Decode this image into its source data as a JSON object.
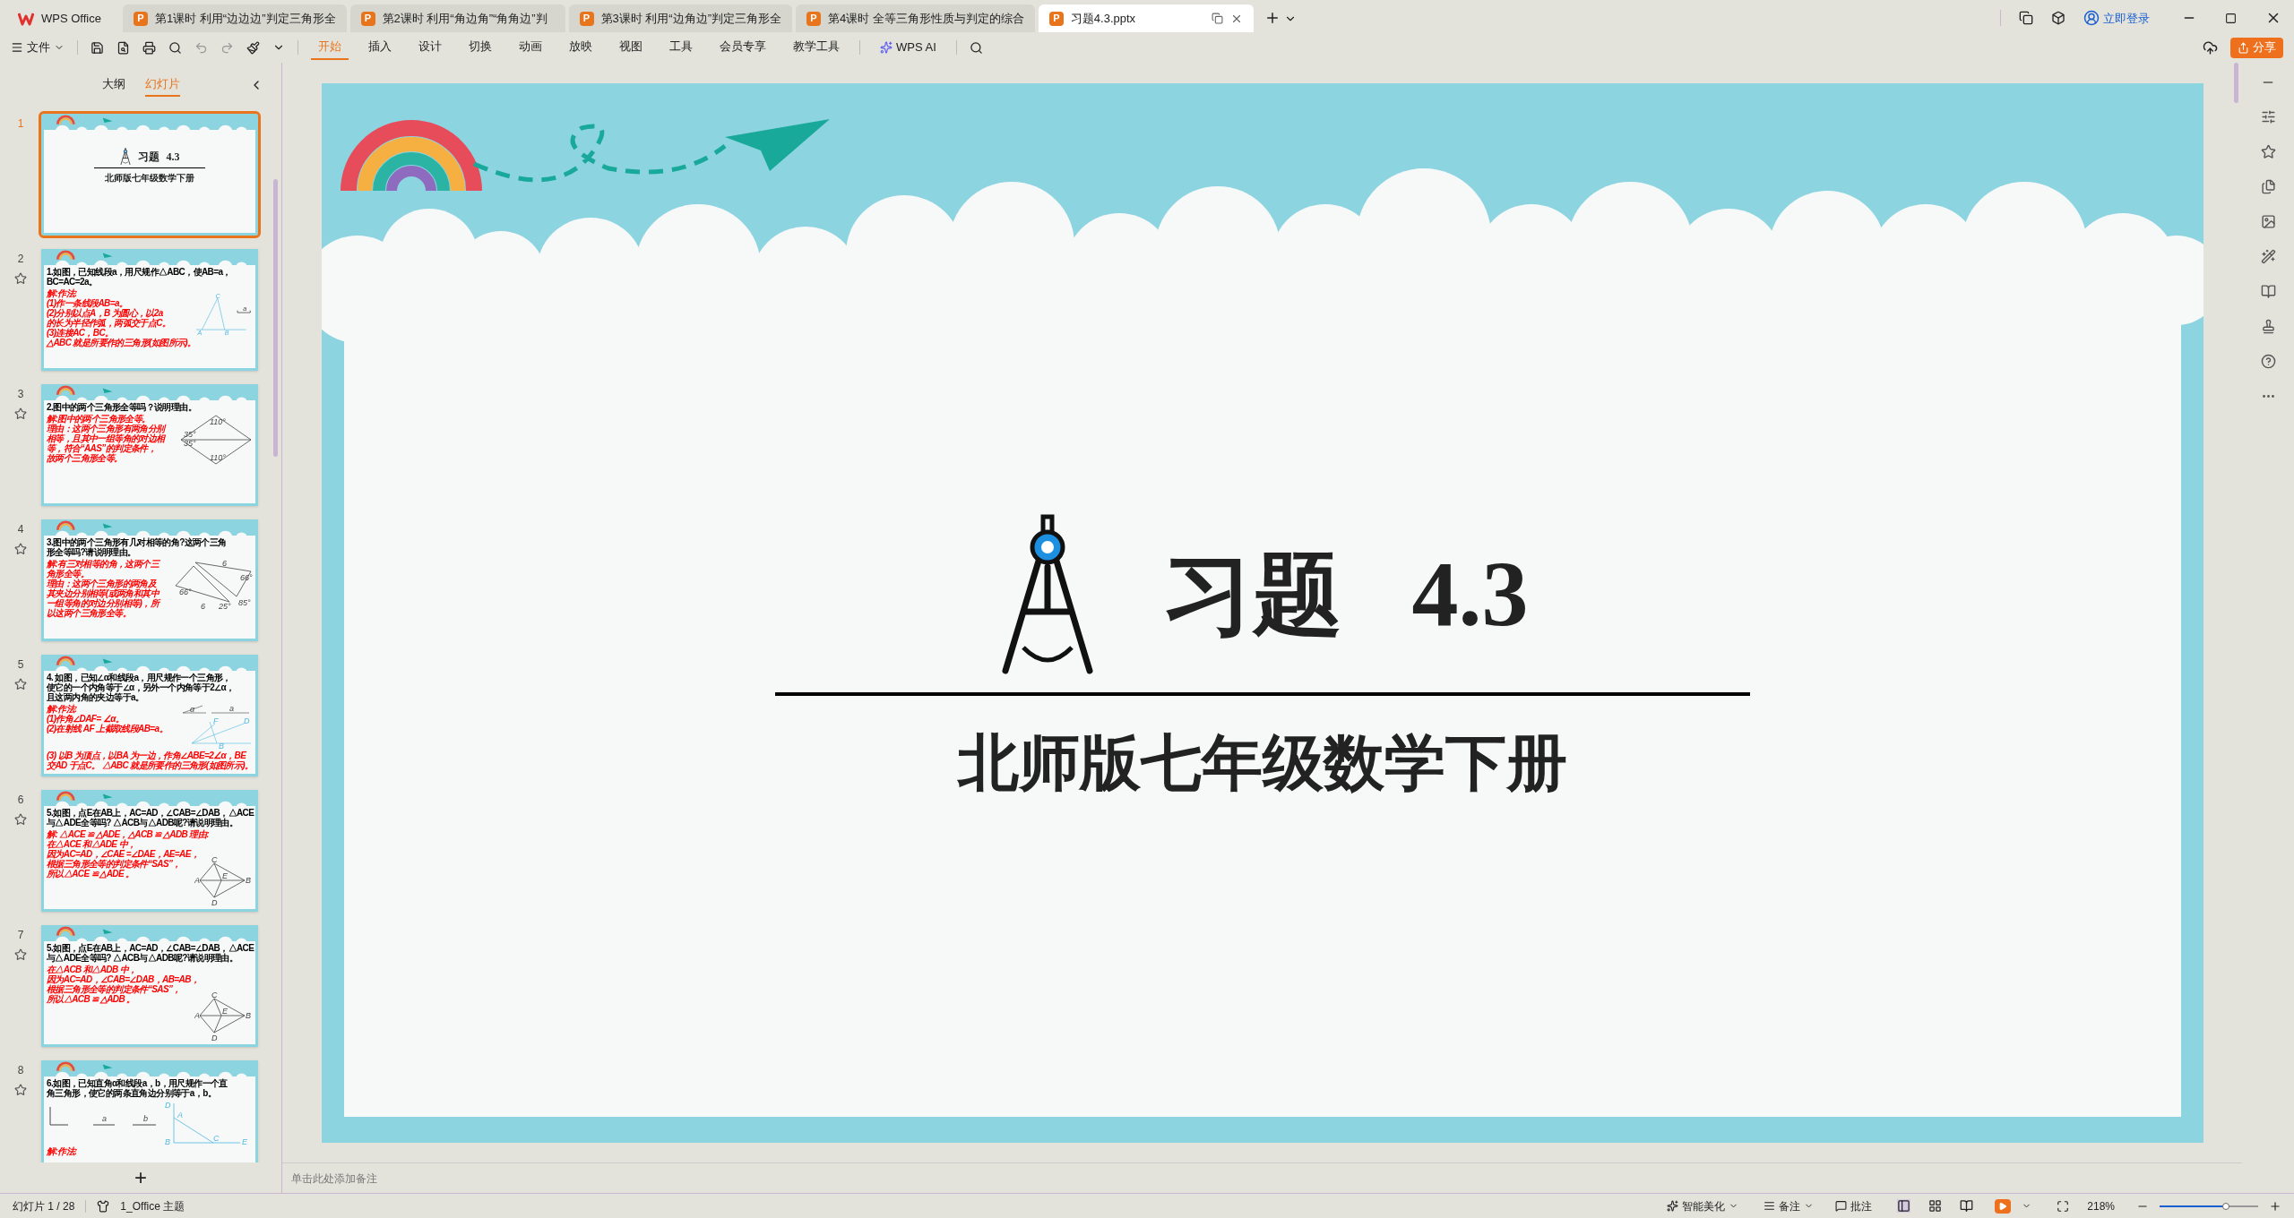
{
  "title_tabs": [
    {
      "kind": "home",
      "label": "WPS Office",
      "selected": false
    },
    {
      "kind": "doc",
      "badge": "P",
      "label": "第1课时 利用“边边边”判定三角形全",
      "selected": false
    },
    {
      "kind": "doc",
      "badge": "P",
      "label": "第2课时 利用“角边角”“角角边”判",
      "selected": false
    },
    {
      "kind": "doc",
      "badge": "P",
      "label": "第3课时 利用“边角边”判定三角形全",
      "selected": false
    },
    {
      "kind": "doc",
      "badge": "P",
      "label": "第4课时 全等三角形性质与判定的综合",
      "selected": false
    },
    {
      "kind": "doc",
      "badge": "P",
      "label": "习题4.3.pptx",
      "selected": true
    }
  ],
  "account": {
    "login": "立即登录"
  },
  "toolbar": {
    "file": "文件",
    "ribbon_tabs": [
      {
        "label": "开始",
        "selected": true
      },
      {
        "label": "插入",
        "selected": false
      },
      {
        "label": "设计",
        "selected": false
      },
      {
        "label": "切换",
        "selected": false
      },
      {
        "label": "动画",
        "selected": false
      },
      {
        "label": "放映",
        "selected": false
      },
      {
        "label": "视图",
        "selected": false
      },
      {
        "label": "工具",
        "selected": false
      },
      {
        "label": "会员专享",
        "selected": false
      },
      {
        "label": "教学工具",
        "selected": false
      }
    ],
    "ai": "WPS AI",
    "share": "分享"
  },
  "sidebar": {
    "tabs": [
      {
        "label": "大纲",
        "selected": false
      },
      {
        "label": "幻灯片",
        "selected": true
      }
    ],
    "slides": [
      {
        "number": "1",
        "kind": "title",
        "selected": true,
        "title": "习题",
        "title_number": "4.3",
        "subtitle": "北师版七年级数学下册"
      },
      {
        "number": "2",
        "kind": "exercise",
        "selected": false,
        "question": [
          "1.如图，已知线段a，用尺规作△ABC，使AB=a，",
          "BC=AC=2a。"
        ],
        "answer": [
          "解:作法:",
          "(1)作一条线段AB=a。",
          "(2)分别以点A，B 为圆心，以2a",
          "的长为半径作弧，两弧交于点C。",
          "(3)连接AC，BC。",
          "△ABC 就是所要作的三角形(如图所示)。"
        ],
        "figure": {
          "kind": "construction",
          "labels": [
            "C",
            "A",
            "B",
            "a"
          ]
        }
      },
      {
        "number": "3",
        "kind": "exercise",
        "selected": false,
        "question": [
          "2.图中的两个三角形全等吗？说明理由。"
        ],
        "answer": [
          "解:图中的两个三角形全等。",
          "理由：这两个三角形有两角分别",
          "相等，且其中一组等角的对边相",
          "等，符合“AAS”的判定条件，",
          "故两个三角形全等。"
        ],
        "figure": {
          "kind": "rhombus",
          "labels": [
            "110°",
            "35°",
            "35°",
            "110°"
          ]
        }
      },
      {
        "number": "4",
        "kind": "exercise",
        "selected": false,
        "question": [
          "3.图中的两个三角形有几对相等的角?这两个三角",
          "形全等吗?请说明理由。"
        ],
        "answer": [
          "解:有三对相等的角，这两个三",
          "角形全等。",
          "理由：这两个三角形的两角及",
          "其夹边分别相等(或两角和其中",
          "一组等角的对边分别相等)，所",
          "以这两个三角形全等。"
        ],
        "figure": {
          "kind": "two-triangles",
          "labels": [
            "6",
            "66°",
            "25°",
            "6",
            "66°",
            "85°"
          ]
        }
      },
      {
        "number": "5",
        "kind": "exercise",
        "selected": false,
        "question": [
          "4. 如图，已知∠α和线段a，用尺规作一个三角形，",
          "使它的一个内角等于∠α，另外一个内角等于2∠α，",
          "且这两内角的夹边等于a。"
        ],
        "answer": [
          "解:作法:",
          "(1)作角∠DAF= ∠α。",
          "(2)在射线 AF 上截取线段AB=a。"
        ],
        "answer_continued": [
          "(3) 以B 为顶点，以BA 为一边，作角∠ABE=2∠α，BE",
          "交AD 于点C。 △ABC 就是所要作的三角形(如图所示)。"
        ],
        "figure": {
          "kind": "angle-construction",
          "labels": [
            "α",
            "a",
            "F",
            "D",
            "B"
          ]
        }
      },
      {
        "number": "6",
        "kind": "exercise",
        "selected": false,
        "question": [
          "5.如图，点E在AB上，AC=AD，∠CAB=∠DAB，△ACE",
          "与△ADE全等吗? △ACB与△ADB呢?请说明理由。"
        ],
        "answer": [
          "解: △ACE ≌ △ADE，△ACB ≌ △ADB 理由:",
          "在△ACE 和△ADE 中，",
          "因为AC=AD，∠CAE =∠DAE，AE=AE，",
          "根据三角形全等的判定条件“SAS”，",
          "所以△ACE ≌ △ADE 。"
        ],
        "figure": {
          "kind": "kite",
          "labels": [
            "C",
            "A",
            "E",
            "B",
            "D"
          ]
        }
      },
      {
        "number": "7",
        "kind": "exercise",
        "selected": false,
        "question": [
          "5.如图，点E在AB上，AC=AD，∠CAB=∠DAB，△ACE",
          "与△ADE全等吗? △ACB与△ADB呢?请说明理由。"
        ],
        "answer": [
          "在△ACB 和△ADB 中，",
          "因为AC=AD，∠CAB=∠DAB，AB=AB，",
          "根据三角形全等的判定条件“SAS”，",
          "所以△ACB ≌ △ADB 。"
        ],
        "figure": {
          "kind": "kite",
          "labels": [
            "C",
            "A",
            "E",
            "B",
            "D"
          ]
        }
      },
      {
        "number": "8",
        "kind": "exercise",
        "selected": false,
        "question": [
          "6.如图，已知直角α和线段a，b，用尺规作一个直",
          "角三角形，使它的两条直角边分别等于a，b。"
        ],
        "answer": [
          "解:作法:"
        ],
        "figure": {
          "kind": "right-triangle",
          "labels": [
            "a",
            "b",
            "D",
            "A",
            "B",
            "C",
            "E"
          ]
        }
      }
    ],
    "add": "+"
  },
  "slide": {
    "title": "习题",
    "title_number": "4.3",
    "subtitle": "北师版七年级数学下册"
  },
  "notes": {
    "placeholder": "单击此处添加备注"
  },
  "status_bar": {
    "slide_count": "幻灯片 1 / 28",
    "theme": "1_Office 主题",
    "beautify": "智能美化",
    "notes": "备注",
    "comments": "批注",
    "zoom": "218%",
    "zoom_slider": {
      "level": 0.67
    }
  }
}
